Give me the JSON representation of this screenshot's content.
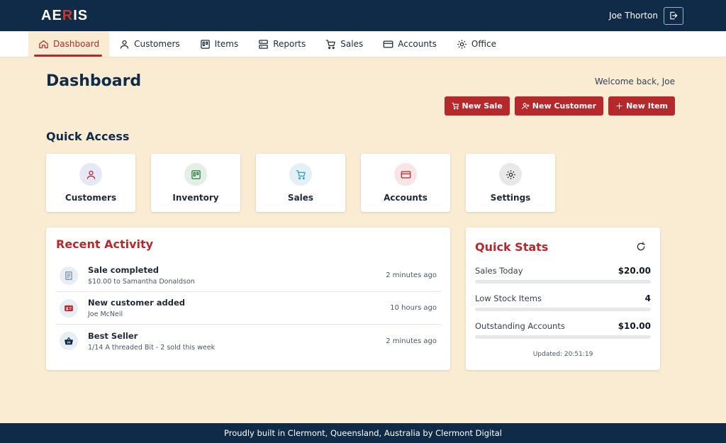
{
  "header": {
    "logo_a": "AE",
    "logo_b": "R",
    "logo_c": "IS",
    "username": "Joe Thorton"
  },
  "nav": {
    "items": [
      {
        "label": "Dashboard",
        "icon": "home-icon",
        "active": true
      },
      {
        "label": "Customers",
        "icon": "user-icon"
      },
      {
        "label": "Items",
        "icon": "board-icon"
      },
      {
        "label": "Reports",
        "icon": "server-icon"
      },
      {
        "label": "Sales",
        "icon": "cart-icon"
      },
      {
        "label": "Accounts",
        "icon": "card-icon"
      },
      {
        "label": "Office",
        "icon": "gear-icon"
      }
    ]
  },
  "main": {
    "title": "Dashboard",
    "welcome": "Welcome back, Joe",
    "actions": {
      "new_sale": "New Sale",
      "new_customer": "New Customer",
      "new_item": "New Item"
    },
    "quick_access_title": "Quick Access",
    "quick_access": [
      {
        "label": "Customers",
        "icon": "user-icon",
        "color": "#e6e8f6"
      },
      {
        "label": "Inventory",
        "icon": "board-icon",
        "color": "#e3eee6"
      },
      {
        "label": "Sales",
        "icon": "cart-icon",
        "color": "#e3f1f6"
      },
      {
        "label": "Accounts",
        "icon": "card-icon",
        "color": "#f8e5e5"
      },
      {
        "label": "Settings",
        "icon": "gear-icon",
        "color": "#e8e8e8"
      }
    ]
  },
  "activity": {
    "title": "Recent Activity",
    "items": [
      {
        "title": "Sale completed",
        "sub": "$10.00 to Samantha Donaldson",
        "time": "2 minutes ago",
        "icon": "receipt-icon"
      },
      {
        "title": "New customer added",
        "sub": "Joe McNeil",
        "time": "10 hours ago",
        "icon": "id-card-icon"
      },
      {
        "title": "Best Seller",
        "sub": "1/14 A threaded Bit - 2 sold this week",
        "time": "2 minutes ago",
        "icon": "basket-icon"
      }
    ]
  },
  "stats": {
    "title": "Quick Stats",
    "items": [
      {
        "label": "Sales Today",
        "value": "$20.00"
      },
      {
        "label": "Low Stock Items",
        "value": "4"
      },
      {
        "label": "Outstanding Accounts",
        "value": "$10.00"
      }
    ],
    "updated": "Updated: 20:51:19"
  },
  "footer": {
    "text": "Proudly built in Clermont, Queensland, Australia by Clermont Digital"
  },
  "colors": {
    "brand_navy": "#0f2b47",
    "brand_red": "#b5282c",
    "background": "#faebd3"
  }
}
